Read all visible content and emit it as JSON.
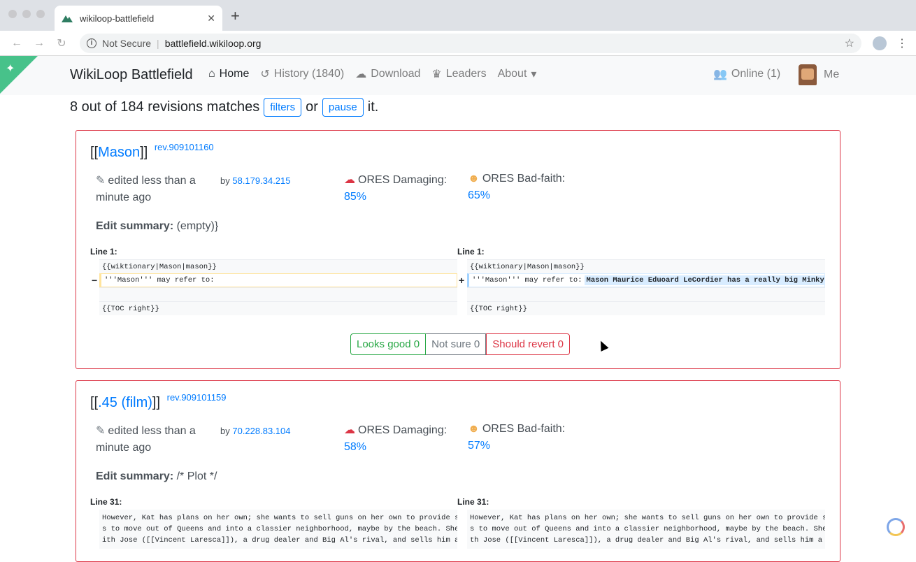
{
  "browser": {
    "tab_title": "wikiloop-battlefield",
    "not_secure": "Not Secure",
    "url": "battlefield.wikiloop.org"
  },
  "navbar": {
    "brand": "WikiLoop Battlefield",
    "links": {
      "home": "Home",
      "history": "History (1840)",
      "download": "Download",
      "leaders": "Leaders",
      "about": "About"
    },
    "online": "Online (1)",
    "me": "Me"
  },
  "summary_line": {
    "prefix": "8 out of 184 revisions matches",
    "filters": "filters",
    "or": "or",
    "pause": "pause",
    "suffix": "it."
  },
  "cards": [
    {
      "title_open": "[[",
      "title": "Mason",
      "title_close": "]]",
      "rev": "rev.909101160",
      "edited": "edited less than a minute ago",
      "by_label": "by",
      "by_user": "58.179.34.215",
      "damaging_label": "ORES Damaging:",
      "damaging": "85%",
      "badfaith_label": "ORES Bad-faith:",
      "badfaith": "65%",
      "summary_label": "Edit summary:",
      "summary": "(empty)}",
      "line_left": "Line 1:",
      "line_right": "Line 1:",
      "left_rows": [
        "{{wiktionary|Mason|mason}}",
        "'''Mason''' may refer to:",
        "",
        "{{TOC right}}"
      ],
      "right_rows": [
        "{{wiktionary|Mason|mason}}",
        "'''Mason''' may refer to:",
        "",
        "{{TOC right}}"
      ],
      "added_text": "Mason Maurice Eduoard LeCordier has a really big Minky",
      "minus": "−",
      "plus": "+",
      "looks_good": "Looks good 0",
      "not_sure": "Not sure 0",
      "should_revert": "Should revert 0"
    },
    {
      "title_open": "[[",
      "title": ".45 (film)",
      "title_close": "]]",
      "rev": "rev.909101159",
      "edited": "edited less than a minute ago",
      "by_label": "by",
      "by_user": "70.228.83.104",
      "damaging_label": "ORES Damaging:",
      "damaging": "58%",
      "badfaith_label": "ORES Bad-faith:",
      "badfaith": "57%",
      "summary_label": "Edit summary:",
      "summary": "/* Plot */",
      "line_left": "Line 31:",
      "line_right": "Line 31:",
      "left_text": [
        "However, Kat has plans on her own; she wants to sell guns on her own to provide since she want",
        "s to move out of Queens and into a classier neighborhood, maybe by the beach. She meets up w",
        "ith Jose ([[Vincent Laresca]]), a drug dealer and Big Al's rival, and sells him a gun. However, Cla"
      ],
      "right_text": [
        "However, Kat has plans on her own; she wants to sell guns on her own to provide since she want",
        "s to move out of Queens and into a classier neighborhood, maybe by the beach. She meets up wi",
        "th Jose ([[Vincent Laresca]]), a drug dealer and Big Al's rival, and sells him a gun. However, Clan"
      ]
    }
  ]
}
